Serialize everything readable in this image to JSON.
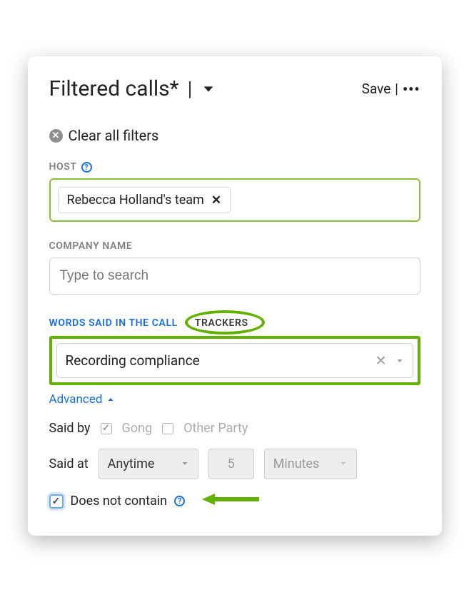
{
  "header": {
    "title": "Filtered calls*",
    "save": "Save"
  },
  "clear_filters": "Clear all filters",
  "host": {
    "label": "HOST",
    "chip": "Rebecca Holland's team"
  },
  "company": {
    "label": "COMPANY NAME",
    "placeholder": "Type to search"
  },
  "tabs": {
    "words": "WORDS SAID IN THE CALL",
    "trackers": "TRACKERS"
  },
  "tracker": {
    "value": "Recording compliance"
  },
  "advanced": "Advanced",
  "said_by": {
    "label": "Said by",
    "gong": "Gong",
    "other": "Other Party"
  },
  "said_at": {
    "label": "Said at",
    "when": "Anytime",
    "num": "5",
    "unit": "Minutes"
  },
  "does_not_contain": "Does not contain",
  "colors": {
    "highlight": "#63b000",
    "link": "#1a6fe0"
  }
}
